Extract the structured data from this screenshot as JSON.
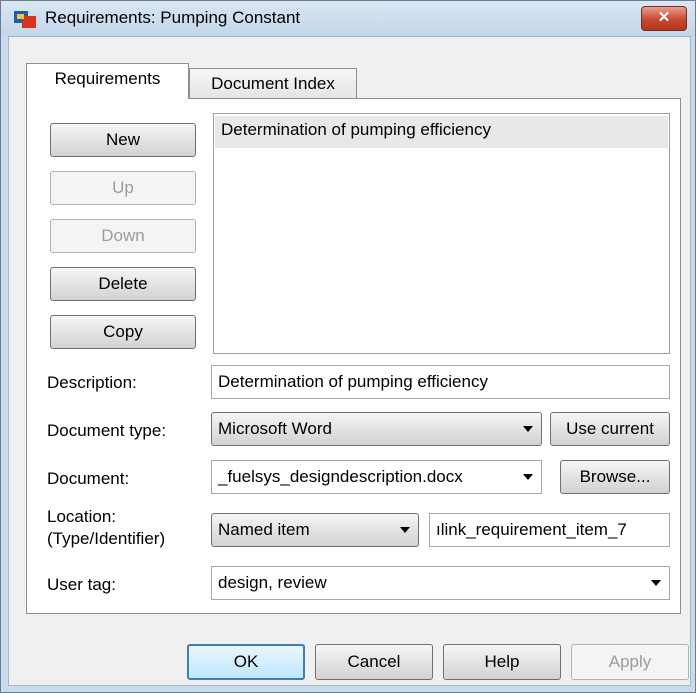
{
  "window": {
    "title": "Requirements: Pumping Constant",
    "close_glyph": "✕"
  },
  "tabs": [
    {
      "label": "Requirements"
    },
    {
      "label": "Document Index"
    }
  ],
  "side_buttons": {
    "new": "New",
    "up": "Up",
    "down": "Down",
    "delete": "Delete",
    "copy": "Copy"
  },
  "requirements_list": [
    "Determination of pumping efficiency"
  ],
  "form": {
    "description_label": "Description:",
    "description_value": "Determination of pumping efficiency",
    "doctype_label": "Document type:",
    "doctype_value": "Microsoft Word",
    "use_current": "Use current",
    "document_label": "Document:",
    "document_value": "_fuelsys_designdescription.docx",
    "browse": "Browse...",
    "location_label_1": "Location:",
    "location_label_2": "(Type/Identifier)",
    "location_type": "Named item",
    "location_identifier": "ılink_requirement_item_7",
    "usertag_label": "User tag:",
    "usertag_value": "design, review"
  },
  "footer": {
    "ok": "OK",
    "cancel": "Cancel",
    "help": "Help",
    "apply": "Apply"
  },
  "icons": {
    "window_icon": "simulink-icon",
    "close_icon": "close-icon",
    "dropdown_icon": "chevron-down-icon"
  }
}
